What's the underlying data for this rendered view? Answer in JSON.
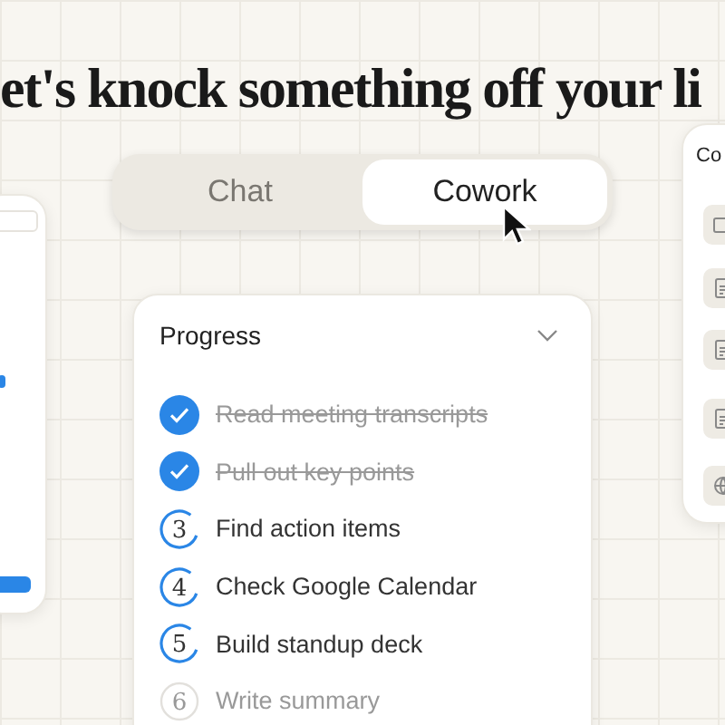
{
  "headline": "et's knock something off your li",
  "mode_toggle": [
    {
      "label": "Chat",
      "selected": false
    },
    {
      "label": "Cowork",
      "selected": true
    }
  ],
  "progress": {
    "title": "Progress",
    "steps": [
      {
        "label": "Read meeting transcripts",
        "kind": "done"
      },
      {
        "label": "Pull out key points",
        "kind": "done"
      },
      {
        "number": "3",
        "label": "Find action items",
        "kind": "active"
      },
      {
        "number": "4",
        "label": "Check Google Calendar",
        "kind": "active"
      },
      {
        "number": "5",
        "label": "Build standup deck",
        "kind": "active"
      },
      {
        "number": "6",
        "label": "Write summary",
        "kind": "pending"
      }
    ]
  },
  "right_panel": {
    "title": "Co",
    "items": [
      {
        "kind": "folder"
      },
      {
        "kind": "doc"
      },
      {
        "kind": "doc"
      },
      {
        "kind": "doc"
      },
      {
        "kind": "globe"
      }
    ]
  }
}
